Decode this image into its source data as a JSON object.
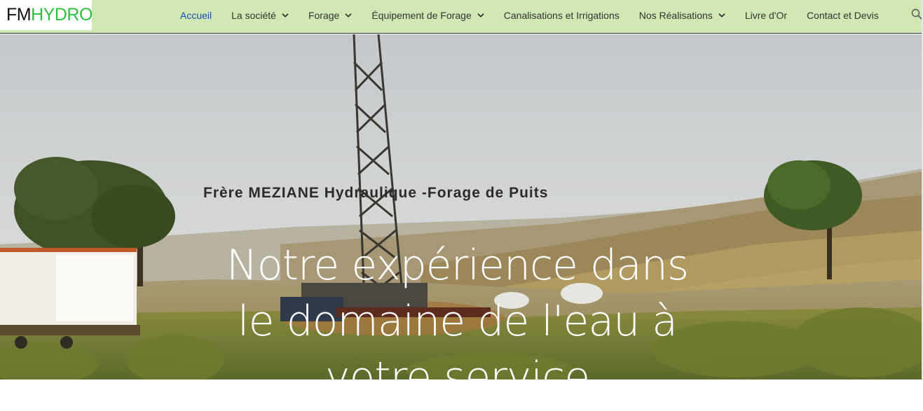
{
  "header": {
    "logo": {
      "part1": "FM",
      "part2": "HYDRO"
    },
    "nav": [
      {
        "label": "Accueil",
        "active": true,
        "has_dropdown": false
      },
      {
        "label": "La société",
        "active": false,
        "has_dropdown": true
      },
      {
        "label": "Forage",
        "active": false,
        "has_dropdown": true
      },
      {
        "label": "Équipement de Forage",
        "active": false,
        "has_dropdown": true
      },
      {
        "label": "Canalisations et Irrigations",
        "active": false,
        "has_dropdown": false
      },
      {
        "label": "Nos Réalisations",
        "active": false,
        "has_dropdown": true
      },
      {
        "label": "Livre d'Or",
        "active": false,
        "has_dropdown": false
      },
      {
        "label": "Contact et Devis",
        "active": false,
        "has_dropdown": false
      }
    ],
    "search_icon": "search-icon"
  },
  "hero": {
    "subtitle": "Frère MEZIANE Hydraulique -Forage de Puits",
    "title_lines": [
      "Notre expérience dans",
      "le domaine de l'eau à",
      "votre service"
    ]
  },
  "colors": {
    "header_bg": "#cfe8b4",
    "logo_green": "#2fbf3f",
    "active_link": "#1a4fb5",
    "hero_text": "#ffffff"
  }
}
